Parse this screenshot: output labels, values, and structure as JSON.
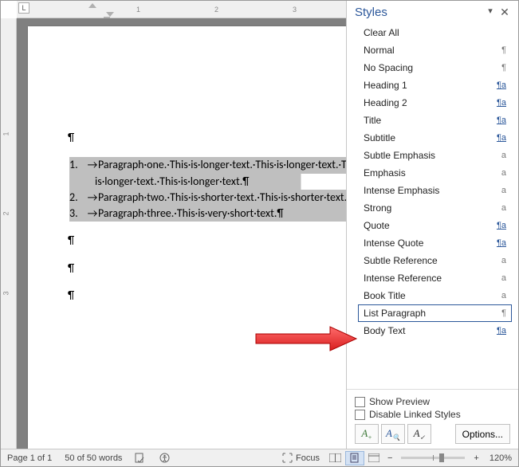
{
  "ruler": {
    "tabchar": "L"
  },
  "doc": {
    "p1_num": "1.",
    "p1_l1": "Paragraph·one.·This·is·longer·text.·This·is·longer·text.·This·is",
    "p1_l2": "is·longer·text.·This·is·longer·text.¶",
    "p2_num": "2.",
    "p2": "Paragraph·two.·This·is·shorter·text.·This·is·shorter·text.",
    "p3_num": "3.",
    "p3": "Paragraph·three.·This·is·very·short·text.¶",
    "pil": "¶",
    "arrow": "→"
  },
  "styles": {
    "title": "Styles",
    "items": [
      {
        "name": "Clear All",
        "mark": "",
        "cls": ""
      },
      {
        "name": "Normal",
        "mark": "¶",
        "cls": ""
      },
      {
        "name": "No Spacing",
        "mark": "¶",
        "cls": ""
      },
      {
        "name": "Heading 1",
        "mark": "¶a",
        "cls": "link"
      },
      {
        "name": "Heading 2",
        "mark": "¶a",
        "cls": "link"
      },
      {
        "name": "Title",
        "mark": "¶a",
        "cls": "link"
      },
      {
        "name": "Subtitle",
        "mark": "¶a",
        "cls": "link"
      },
      {
        "name": "Subtle Emphasis",
        "mark": "a",
        "cls": ""
      },
      {
        "name": "Emphasis",
        "mark": "a",
        "cls": ""
      },
      {
        "name": "Intense Emphasis",
        "mark": "a",
        "cls": ""
      },
      {
        "name": "Strong",
        "mark": "a",
        "cls": ""
      },
      {
        "name": "Quote",
        "mark": "¶a",
        "cls": "link"
      },
      {
        "name": "Intense Quote",
        "mark": "¶a",
        "cls": "link"
      },
      {
        "name": "Subtle Reference",
        "mark": "a",
        "cls": ""
      },
      {
        "name": "Intense Reference",
        "mark": "a",
        "cls": ""
      },
      {
        "name": "Book Title",
        "mark": "a",
        "cls": ""
      },
      {
        "name": "List Paragraph",
        "mark": "¶",
        "cls": "",
        "selected": true
      },
      {
        "name": "Body Text",
        "mark": "¶a",
        "cls": "link"
      }
    ],
    "show_preview": "Show Preview",
    "disable_linked": "Disable Linked Styles",
    "options": "Options..."
  },
  "status": {
    "page": "Page 1 of 1",
    "words": "50 of 50 words",
    "focus": "Focus",
    "zoom": "120%"
  }
}
